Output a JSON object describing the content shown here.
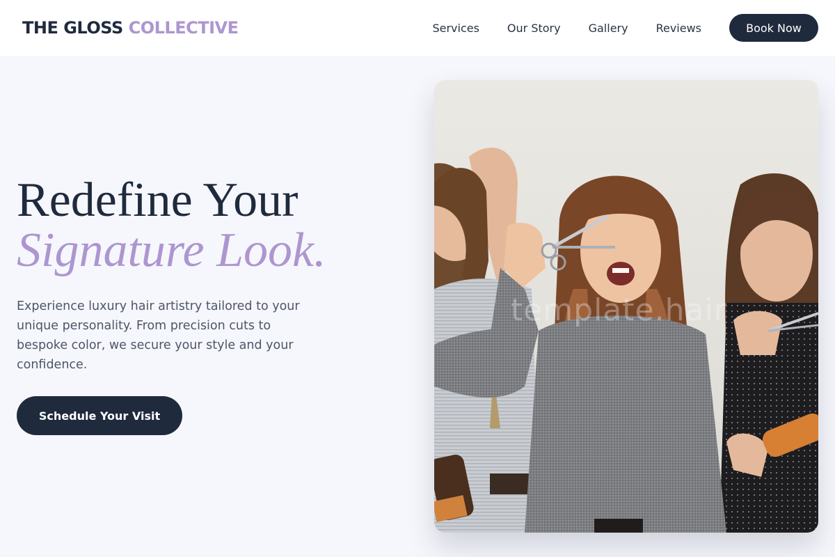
{
  "brand": {
    "name_main": "THE GLOSS",
    "name_accent": "COLLECTIVE"
  },
  "nav": {
    "items": [
      {
        "label": "Services"
      },
      {
        "label": "Our Story"
      },
      {
        "label": "Gallery"
      },
      {
        "label": "Reviews"
      }
    ],
    "cta_label": "Book Now"
  },
  "hero": {
    "headline_line1": "Redefine Your",
    "headline_line2": "Signature Look.",
    "description": "Experience luxury hair artistry tailored to your unique personality. From precision cuts to bespoke color, we secure your style and your confidence.",
    "cta_label": "Schedule Your Visit",
    "image_watermark": "template.hair"
  },
  "colors": {
    "navy": "#1f2a3d",
    "lavender": "#ad96d0",
    "page_bg": "#f6f7fc",
    "body_text": "#4d5567"
  }
}
